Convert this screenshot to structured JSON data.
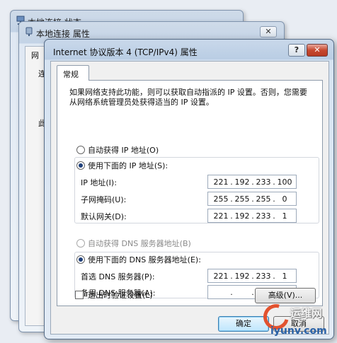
{
  "background_windows": {
    "back_title": "本地连接 状态",
    "middle_title": "本地连接 属性",
    "middle_close": "✕",
    "middle_tab_fragment": "网",
    "middle_label1": "连",
    "middle_label2": "此"
  },
  "dialog": {
    "title": "Internet 协议版本 4 (TCP/IPv4) 属性",
    "help_button": "?",
    "close_button": "✕",
    "tab_label": "常规",
    "description": "如果网络支持此功能，则可以获取自动指派的 IP 设置。否则，您需要从网络系统管理员处获得适当的 IP 设置。",
    "ip_auto_label": "自动获得 IP 地址(O)",
    "ip_manual_label": "使用下面的 IP 地址(S):",
    "ip_address_label": "IP 地址(I):",
    "ip_address": [
      "221",
      "192",
      "233",
      "100"
    ],
    "subnet_label": "子网掩码(U):",
    "subnet": [
      "255",
      "255",
      "255",
      "0"
    ],
    "gateway_label": "默认网关(D):",
    "gateway": [
      "221",
      "192",
      "233",
      "1"
    ],
    "dns_auto_label": "自动获得 DNS 服务器地址(B)",
    "dns_manual_label": "使用下面的 DNS 服务器地址(E):",
    "preferred_dns_label": "首选 DNS 服务器(P):",
    "preferred_dns": [
      "221",
      "192",
      "233",
      "1"
    ],
    "alternate_dns_label": "备用 DNS 服务器(A):",
    "alternate_dns": [
      "",
      "",
      "",
      ""
    ],
    "validate_label": "退出时验证设置(L)",
    "advanced_button": "高级(V)...",
    "ok_button": "确定",
    "cancel_button": "取消"
  },
  "watermark": {
    "line1": "运维网",
    "line2": "iyunv.com"
  },
  "colors": {
    "title_bar": "#c9d8ea",
    "close_red": "#c7482f",
    "primary_button_border": "#3c7fb1",
    "watermark_red": "#e2522f",
    "watermark_blue": "#2a62a8"
  }
}
